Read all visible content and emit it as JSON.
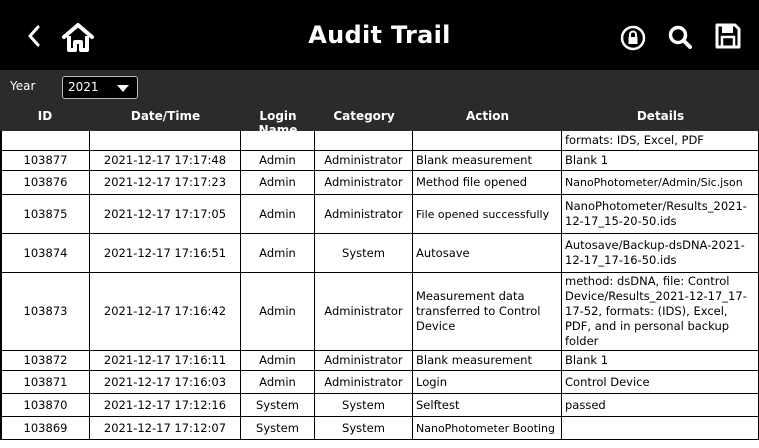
{
  "header": {
    "title": "Audit Trail",
    "back_icon": "chevron-left-icon",
    "home_icon": "home-icon",
    "lock_icon": "lock-icon",
    "search_icon": "search-icon",
    "save_icon": "save-icon"
  },
  "filter": {
    "year_label": "Year",
    "year_value": "2021"
  },
  "table": {
    "columns": [
      "ID",
      "Date/Time",
      "Login Name",
      "Category",
      "Action",
      "Details"
    ],
    "partial_row": {
      "id": "",
      "datetime": "",
      "login": "",
      "category": "",
      "action": "",
      "details": "formats: IDS, Excel, PDF"
    },
    "rows": [
      {
        "id": "103877",
        "datetime": "2021-12-17 17:17:48",
        "login": "Admin",
        "category": "Administrator",
        "action": "Blank measurement",
        "details": "Blank 1"
      },
      {
        "id": "103876",
        "datetime": "2021-12-17 17:17:23",
        "login": "Admin",
        "category": "Administrator",
        "action": "Method file opened",
        "details": "NanoPhotometer/Admin/Sic.json"
      },
      {
        "id": "103875",
        "datetime": "2021-12-17 17:17:05",
        "login": "Admin",
        "category": "Administrator",
        "action": "File opened successfully",
        "details": "NanoPhotometer/Results_2021-12-17_15-20-50.ids"
      },
      {
        "id": "103874",
        "datetime": "2021-12-17 17:16:51",
        "login": "Admin",
        "category": "System",
        "action": "Autosave",
        "details": "Autosave/Backup-dsDNA-2021-12-17_17-16-50.ids"
      },
      {
        "id": "103873",
        "datetime": "2021-12-17 17:16:42",
        "login": "Admin",
        "category": "Administrator",
        "action": "Measurement data transferred to Control Device",
        "details": "method: dsDNA, file: Control Device/Results_2021-12-17_17-17-52, formats: (IDS), Excel, PDF, and in personal backup folder"
      },
      {
        "id": "103872",
        "datetime": "2021-12-17 17:16:11",
        "login": "Admin",
        "category": "Administrator",
        "action": "Blank measurement",
        "details": "Blank 1"
      },
      {
        "id": "103871",
        "datetime": "2021-12-17 17:16:03",
        "login": "Admin",
        "category": "Administrator",
        "action": "Login",
        "details": "Control Device"
      },
      {
        "id": "103870",
        "datetime": "2021-12-17 17:12:16",
        "login": "System",
        "category": "System",
        "action": "Selftest",
        "details": "passed"
      },
      {
        "id": "103869",
        "datetime": "2021-12-17 17:12:07",
        "login": "System",
        "category": "System",
        "action": "NanoPhotometer Booting",
        "details": ""
      }
    ]
  }
}
